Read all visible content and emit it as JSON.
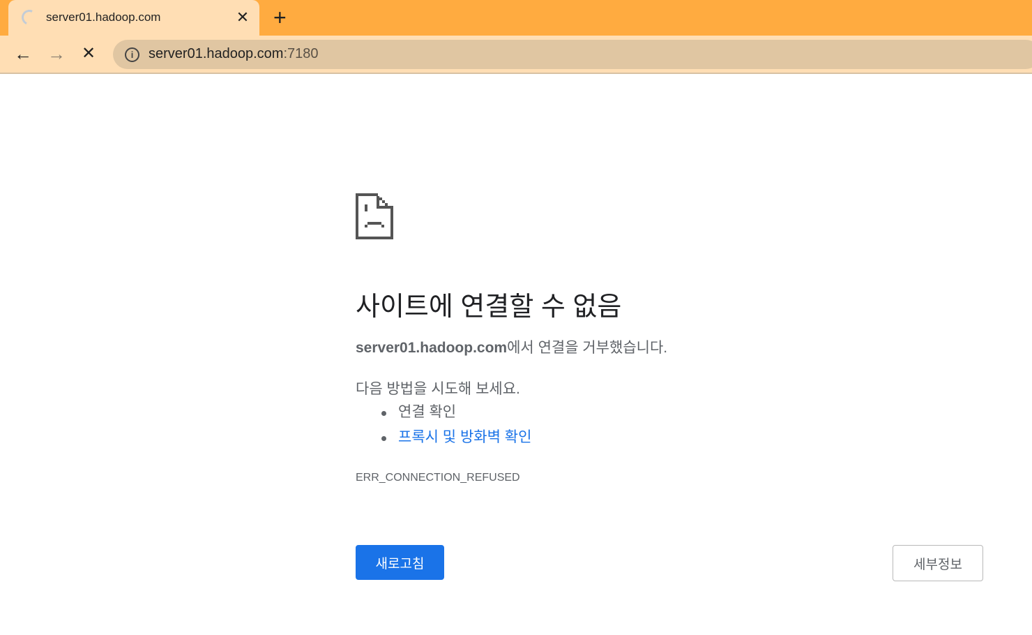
{
  "tab": {
    "title": "server01.hadoop.com",
    "close": "✕",
    "new_tab": "+"
  },
  "toolbar": {
    "back": "←",
    "forward": "→",
    "stop": "✕",
    "info": "i",
    "url_host": "server01.hadoop.com",
    "url_port": ":7180"
  },
  "error": {
    "title": "사이트에 연결할 수 없음",
    "host": "server01.hadoop.com",
    "message": "에서 연결을 거부했습니다.",
    "try_heading": "다음 방법을 시도해 보세요.",
    "suggestions": [
      "연결 확인",
      "프록시 및 방화벽 확인"
    ],
    "code": "ERR_CONNECTION_REFUSED",
    "reload_label": "새로고침",
    "details_label": "세부정보"
  }
}
